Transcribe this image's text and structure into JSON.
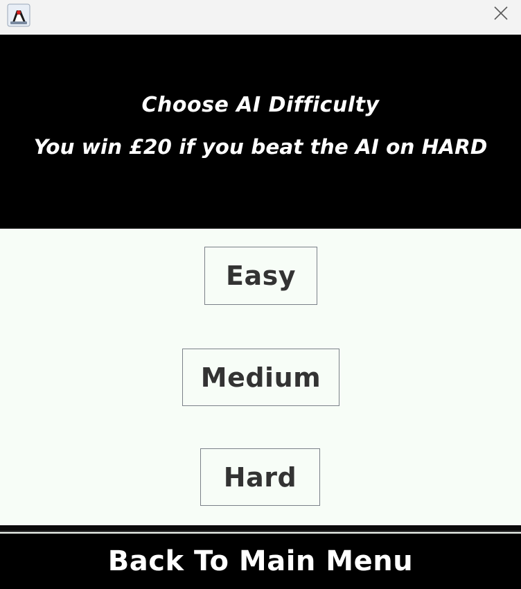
{
  "titlebar": {
    "app_icon": "java-duke-icon",
    "close_icon": "close-icon"
  },
  "header": {
    "title": "Choose AI Difficulty",
    "subtitle": "You win £20 if you beat the AI on HARD"
  },
  "difficulty": {
    "easy_label": "Easy",
    "medium_label": "Medium",
    "hard_label": "Hard"
  },
  "footer": {
    "back_label": "Back To Main Menu"
  },
  "colors": {
    "header_bg": "#000000",
    "content_bg": "#f7fdf7",
    "button_text": "#333333",
    "button_border": "#7a8088",
    "titlebar_bg": "#f3f3f3"
  }
}
